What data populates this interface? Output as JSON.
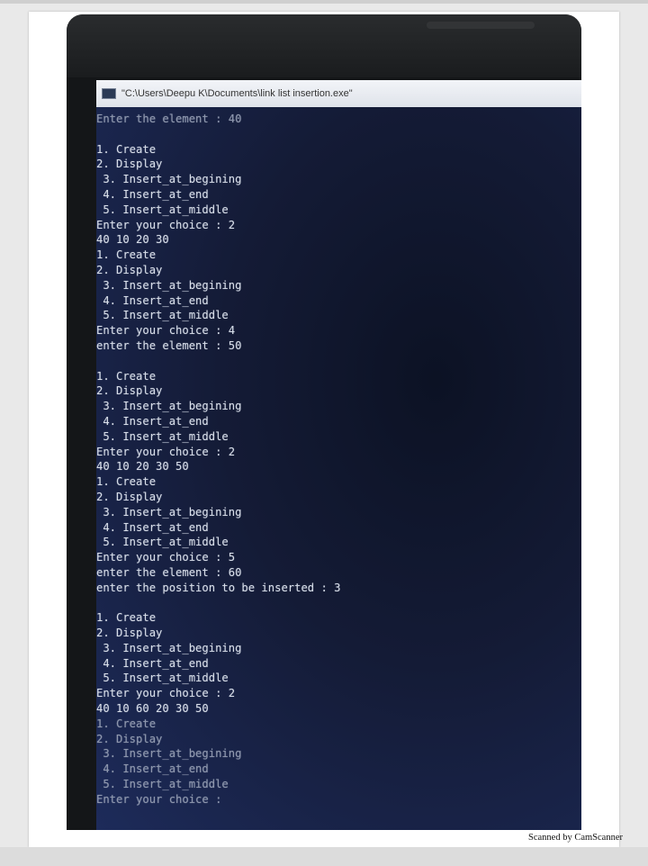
{
  "window": {
    "title": "\"C:\\Users\\Deepu K\\Documents\\link list insertion.exe\""
  },
  "console_lines": [
    "Enter the element : 40",
    "",
    "1. Create",
    "2. Display",
    " 3. Insert_at_begining",
    " 4. Insert_at_end",
    " 5. Insert_at_middle",
    "Enter your choice : 2",
    "40 10 20 30",
    "1. Create",
    "2. Display",
    " 3. Insert_at_begining",
    " 4. Insert_at_end",
    " 5. Insert_at_middle",
    "Enter your choice : 4",
    "enter the element : 50",
    "",
    "1. Create",
    "2. Display",
    " 3. Insert_at_begining",
    " 4. Insert_at_end",
    " 5. Insert_at_middle",
    "Enter your choice : 2",
    "40 10 20 30 50",
    "1. Create",
    "2. Display",
    " 3. Insert_at_begining",
    " 4. Insert_at_end",
    " 5. Insert_at_middle",
    "Enter your choice : 5",
    "enter the element : 60",
    "enter the position to be inserted : 3",
    "",
    "1. Create",
    "2. Display",
    " 3. Insert_at_begining",
    " 4. Insert_at_end",
    " 5. Insert_at_middle",
    "Enter your choice : 2",
    "40 10 60 20 30 50",
    "1. Create",
    "2. Display",
    " 3. Insert_at_begining",
    " 4. Insert_at_end",
    " 5. Insert_at_middle",
    "Enter your choice :"
  ],
  "footer": {
    "scan_credit": "Scanned by CamScanner"
  },
  "colors": {
    "console_bg": "#141b36",
    "console_text": "#d7dde8",
    "titlebar_bg": "#e6e9ef"
  }
}
